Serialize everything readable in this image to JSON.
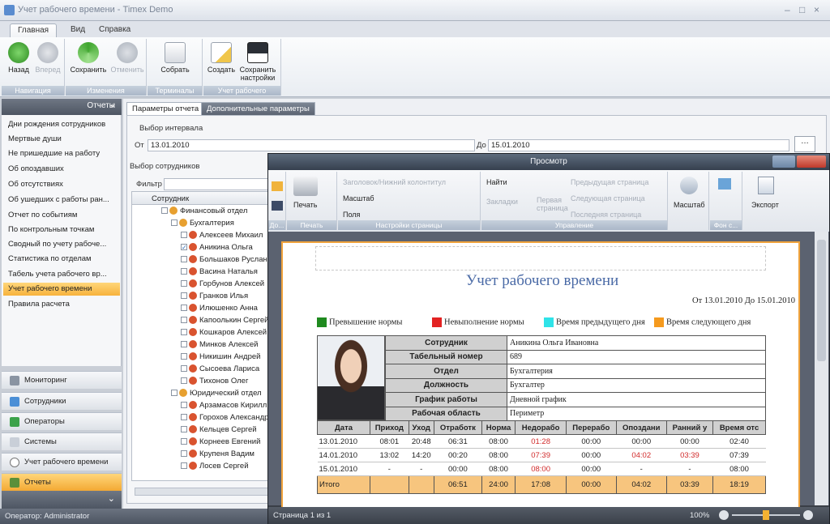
{
  "window": {
    "title": "Учет рабочего времени - Timex Demo",
    "min": "–",
    "max": "□",
    "close": "×"
  },
  "menu_tabs": [
    "Главная",
    "Вид",
    "Справка"
  ],
  "ribbon": {
    "groups": [
      {
        "label": "Навигация",
        "buttons": [
          "Назад",
          "Вперед"
        ]
      },
      {
        "label": "Изменения",
        "buttons": [
          "Сохранить",
          "Отменить"
        ]
      },
      {
        "label": "Терминалы",
        "buttons": [
          "Собрать"
        ]
      },
      {
        "label": "Учет рабочего времени",
        "buttons": [
          "Создать",
          "Сохранить настройки"
        ]
      }
    ]
  },
  "left": {
    "header": "Отчеты",
    "collapse": "«",
    "items": [
      "Дни рождения сотрудников",
      "Мертвые души",
      "Не пришедшие на работу",
      "Об опоздавших",
      "Об отсутствиях",
      "Об ушедших с работы ран...",
      "Отчет по событиям",
      "По контрольным точкам",
      "Сводный по учету рабоче...",
      "Статистика по отделам",
      "Табель учета рабочего вр...",
      "Учет рабочего времени",
      "Правила расчета"
    ],
    "nav": [
      "Мониторинг",
      "Сотрудники",
      "Операторы",
      "Системы",
      "Учет рабочего времени",
      "Отчеты"
    ],
    "more": "⌄"
  },
  "status": "Оператор: Administrator",
  "content": {
    "tabs": [
      "Параметры отчета",
      "Дополнительные параметры"
    ],
    "interval_label": "Выбор интервала",
    "from_label": "От",
    "from_value": "13.01.2010",
    "to_label": "До",
    "to_value": "15.01.2010",
    "emp_label": "Выбор сотрудников",
    "filter_label": "Фильтр",
    "tree_header": "Сотрудник",
    "tree": [
      {
        "t": "Финансовый отдел",
        "lvl": 0,
        "dept": true
      },
      {
        "t": "Бухгалтерия",
        "lvl": 1,
        "dept": true
      },
      {
        "t": "Алексеев Михаил",
        "lvl": 2
      },
      {
        "t": "Аникина Ольга",
        "lvl": 2,
        "checked": true
      },
      {
        "t": "Большаков Руслан",
        "lvl": 2
      },
      {
        "t": "Васина Наталья",
        "lvl": 2
      },
      {
        "t": "Горбунов Алексей",
        "lvl": 2
      },
      {
        "t": "Гранков Илья",
        "lvl": 2
      },
      {
        "t": "Илюшенко Анна",
        "lvl": 2
      },
      {
        "t": "Капоолькин Сергей",
        "lvl": 2
      },
      {
        "t": "Кошкаров Алексей",
        "lvl": 2
      },
      {
        "t": "Минков Алексей",
        "lvl": 2
      },
      {
        "t": "Никишин Андрей",
        "lvl": 2
      },
      {
        "t": "Сысоева Лариса",
        "lvl": 2
      },
      {
        "t": "Тихонов Олег",
        "lvl": 2
      },
      {
        "t": "Юридический отдел",
        "lvl": 1,
        "dept": true
      },
      {
        "t": "Арзамасов Кирилл",
        "lvl": 2
      },
      {
        "t": "Горохов Александр",
        "lvl": 2
      },
      {
        "t": "Кельцев Сергей",
        "lvl": 2
      },
      {
        "t": "Корнеев Евгений",
        "lvl": 2
      },
      {
        "t": "Крупеня Вадим",
        "lvl": 2
      },
      {
        "t": "Лосев Сергей",
        "lvl": 2
      }
    ]
  },
  "preview": {
    "title": "Просмотр",
    "ribbon": {
      "print": "Печать",
      "doc": "До...",
      "header_footer": "Заголовок/Нижний колонтитул",
      "scale": "Масштаб",
      "fields": "Поля",
      "page_settings": "Настройки страницы",
      "find": "Найти",
      "bookmarks": "Закладки",
      "first_page": "Первая страница",
      "prev_page": "Предыдущая страница",
      "next_page": "Следующая страница",
      "last_page": "Последняя страница",
      "control": "Управление",
      "zoom": "Масштаб",
      "bg": "Фон с...",
      "export": "Экспорт"
    },
    "status": "Страница 1 из 1",
    "zoom": "100%"
  },
  "report": {
    "title": "Учет рабочего времени",
    "date_range": "От 13.01.2010 До 15.01.2010",
    "legend": [
      {
        "label": "Превышение нормы",
        "color": "#1f8a1f"
      },
      {
        "label": "Невыполнение нормы",
        "color": "#e32222"
      },
      {
        "label": "Время предыдущего дня",
        "color": "#2fe3e8"
      },
      {
        "label": "Время следующего дня",
        "color": "#f59a1e"
      }
    ],
    "info": [
      [
        "Сотрудник",
        "Аникина Ольга Ивановна"
      ],
      [
        "Табельный номер",
        "689"
      ],
      [
        "Отдел",
        "Бухгалтерия"
      ],
      [
        "Должность",
        "Бухгалтер"
      ],
      [
        "График работы",
        "Дневной график"
      ],
      [
        "Рабочая область",
        "Периметр"
      ]
    ],
    "columns": [
      "Дата",
      "Приход",
      "Уход",
      "Отработк",
      "Норма",
      "Недорабо",
      "Перерабо",
      "Опоздани",
      "Ранний у",
      "Время отс"
    ],
    "rows": [
      [
        "13.01.2010",
        "08:01",
        "20:48",
        "06:31",
        "08:00",
        "01:28",
        "00:00",
        "00:00",
        "00:00",
        "02:40"
      ],
      [
        "14.01.2010",
        "13:02",
        "14:20",
        "00:20",
        "08:00",
        "07:39",
        "00:00",
        "04:02",
        "03:39",
        "07:39"
      ],
      [
        "15.01.2010",
        "-",
        "-",
        "00:00",
        "08:00",
        "08:00",
        "00:00",
        "-",
        "-",
        "08:00"
      ]
    ],
    "red_cols": [
      5,
      7,
      8
    ],
    "total": [
      "Итого",
      "",
      "",
      "06:51",
      "24:00",
      "17:08",
      "00:00",
      "04:02",
      "03:39",
      "18:19"
    ]
  }
}
